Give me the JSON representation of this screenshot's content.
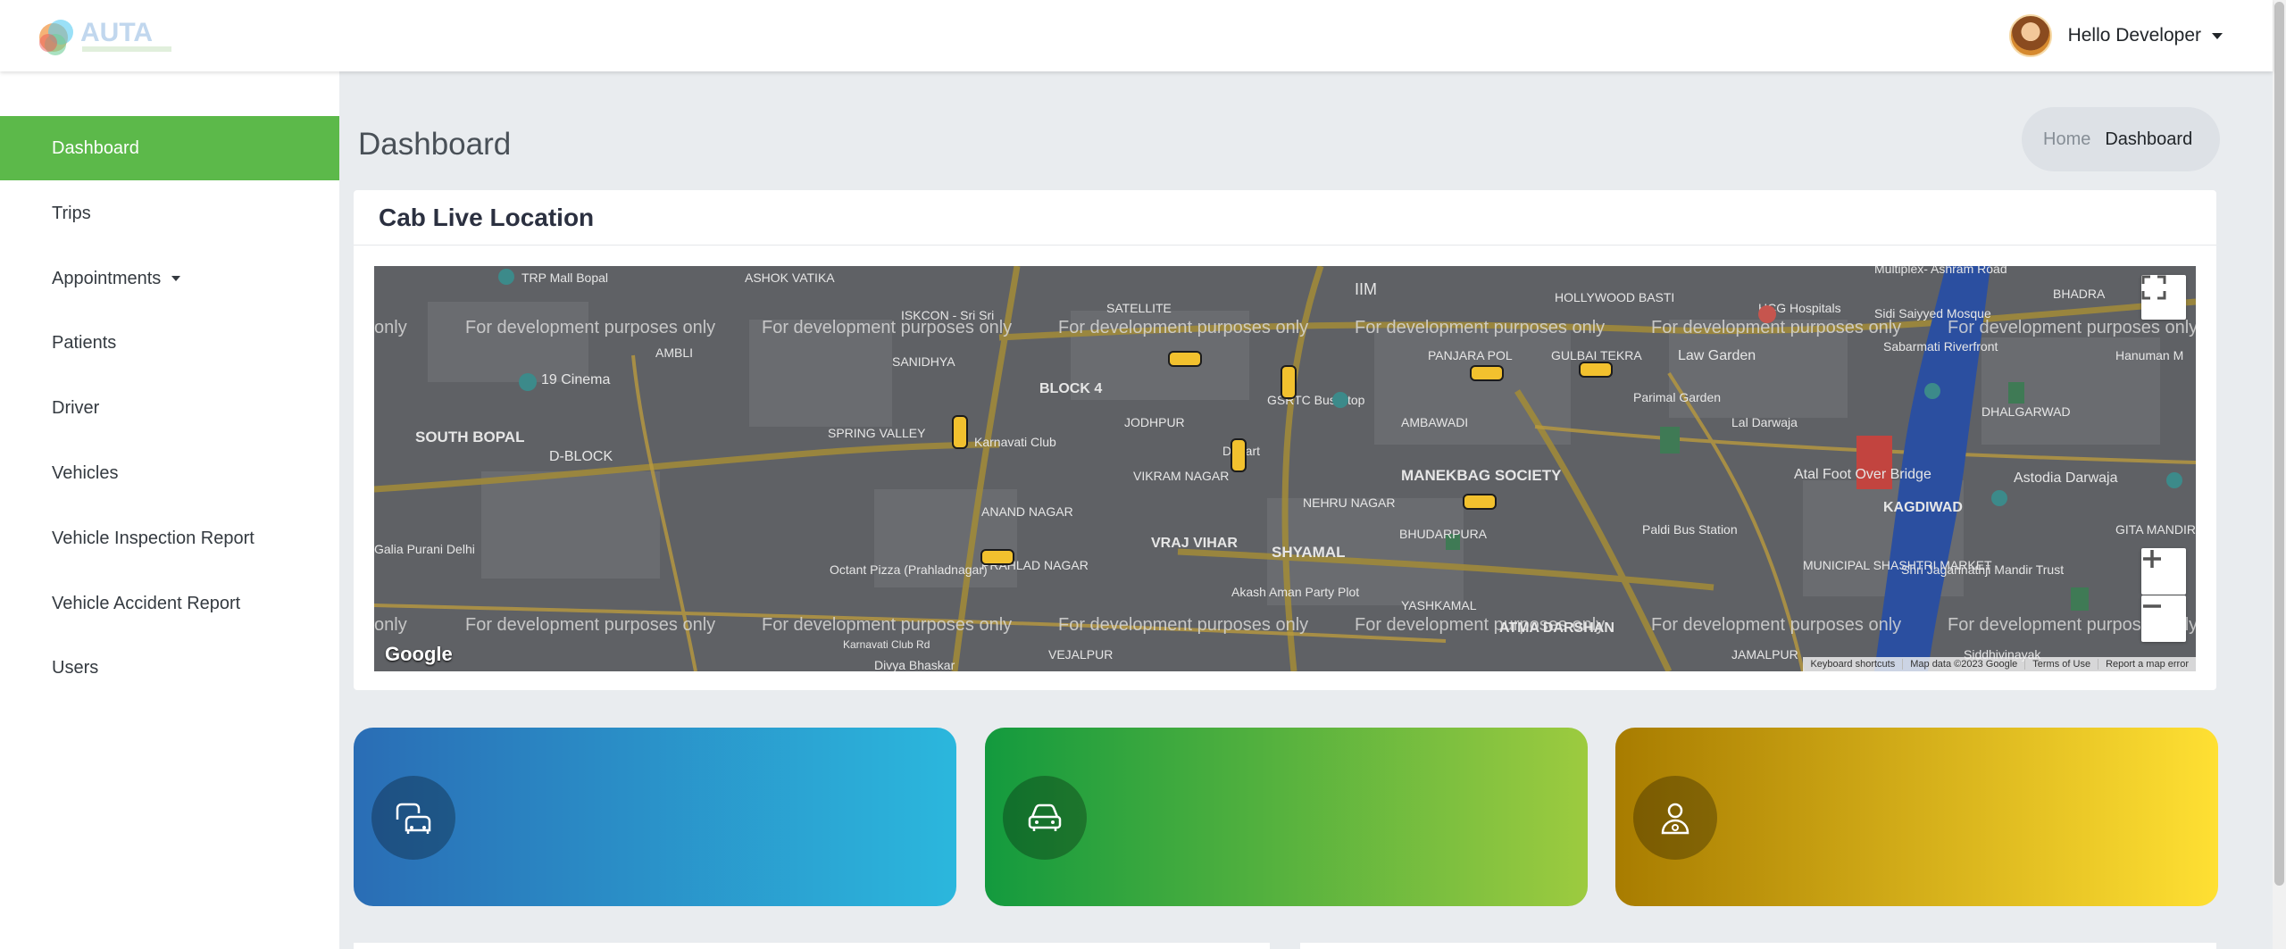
{
  "header": {
    "logo_text": "AUTA",
    "user_name": "Hello Developer"
  },
  "sidebar": {
    "items": [
      {
        "label": "Dashboard",
        "active": true
      },
      {
        "label": "Trips"
      },
      {
        "label": "Appointments",
        "has_dropdown": true
      },
      {
        "label": "Patients"
      },
      {
        "label": "Driver"
      },
      {
        "label": "Vehicles"
      },
      {
        "label": "Vehicle Inspection Report"
      },
      {
        "label": "Vehicle Accident Report"
      },
      {
        "label": "Users"
      }
    ]
  },
  "page": {
    "title": "Dashboard",
    "breadcrumb": {
      "home": "Home",
      "current": "Dashboard"
    }
  },
  "map_card": {
    "title": "Cab Live Location",
    "watermark": "For development purposes only",
    "google_label": "Google",
    "footer": [
      "Keyboard shortcuts",
      "Map data ©2023 Google",
      "Terms of Use",
      "Report a map error"
    ],
    "labels": [
      "TRP Mall Bopal",
      "ASHOK VATIKA",
      "ISKCON - Sri Sri",
      "SATELLITE",
      "IIM",
      "HOLLYWOOD BASTI",
      "HCG Hospitals",
      "Sidi Saiyyed Mosque",
      "BHADRA",
      "Multiplex- Ashram Road",
      "AMBLI",
      "SANIDHYA",
      "19 Cinema",
      "BLOCK 4",
      "GSRTC Bus Stop",
      "PANJARA POL",
      "GULBAI TEKRA",
      "Law Garden",
      "Sabarmati Riverfront",
      "Hanuman M",
      "SOUTH BOPAL",
      "D-BLOCK",
      "SPRING VALLEY",
      "Karnavati Club",
      "JODHPUR",
      "D Mart",
      "AMBAWADI",
      "Parimal Garden",
      "Lal Darwaja",
      "DHALGARWAD",
      "ANAND NAGAR",
      "VIKRAM NAGAR",
      "NEHRU NAGAR",
      "MANEKBAG SOCIETY",
      "Atal Foot Over Bridge",
      "Astodia Darwaja",
      "KAGDIWAD",
      "GITA MANDIR",
      "Galia Purani Delhi",
      "Octant Pizza (Prahladnagar)",
      "PRAHLAD NAGAR",
      "VRAJ VIHAR",
      "SHYAMAL",
      "BHUDARPURA",
      "Paldi Bus Station",
      "MUNICIPAL SHASHTRI MARKET",
      "Shri Jagannathji Mandir Trust",
      "Akash Aman Party Plot",
      "YASHKAMAL",
      "ATMA DARSHAN",
      "VEJALPUR",
      "Divya Bhaskar",
      "Karnavati Club Rd",
      "JAMALPUR",
      "Siddhivinayak"
    ]
  },
  "stats": [
    {
      "icon": "cabs-icon",
      "colors": [
        "#2a6db5",
        "#2bb7dd"
      ]
    },
    {
      "icon": "car-icon",
      "colors": [
        "#139a3e",
        "#9dcb3f"
      ]
    },
    {
      "icon": "driver-icon",
      "colors": [
        "#a87c00",
        "#ffe033"
      ]
    }
  ]
}
